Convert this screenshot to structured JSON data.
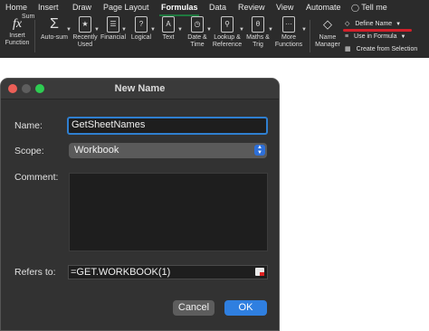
{
  "ribbon": {
    "tabs": [
      "Home",
      "Insert",
      "Draw",
      "Page Layout",
      "Formulas",
      "Data",
      "Review",
      "View",
      "Automate"
    ],
    "tell_me": "Tell me",
    "sum_label": "Sum",
    "insert_function": [
      "Insert",
      "Function"
    ],
    "groups": {
      "autosum": [
        "Auto-sum",
        ""
      ],
      "recently_used": [
        "Recently",
        "Used"
      ],
      "financial": [
        "Financial",
        ""
      ],
      "logical": [
        "Logical",
        ""
      ],
      "text": [
        "Text",
        ""
      ],
      "date_time": [
        "Date &",
        "Time"
      ],
      "lookup": [
        "Lookup &",
        "Reference"
      ],
      "maths": [
        "Maths &",
        "Trig"
      ],
      "more": [
        "More",
        "Functions"
      ],
      "name_manager": [
        "Name",
        "Manager"
      ]
    },
    "define_name": "Define Name",
    "use_in_formula": "Use in Formula",
    "create_from_selection": "Create from Selection",
    "accent_color": "#d3202a"
  },
  "dialog": {
    "title": "New Name",
    "name_label": "Name:",
    "name_value": "GetSheetNames",
    "scope_label": "Scope:",
    "scope_value": "Workbook",
    "comment_label": "Comment:",
    "comment_value": "",
    "refers_label": "Refers to:",
    "refers_value": "=GET.WORKBOOK(1)",
    "cancel": "Cancel",
    "ok": "OK"
  }
}
